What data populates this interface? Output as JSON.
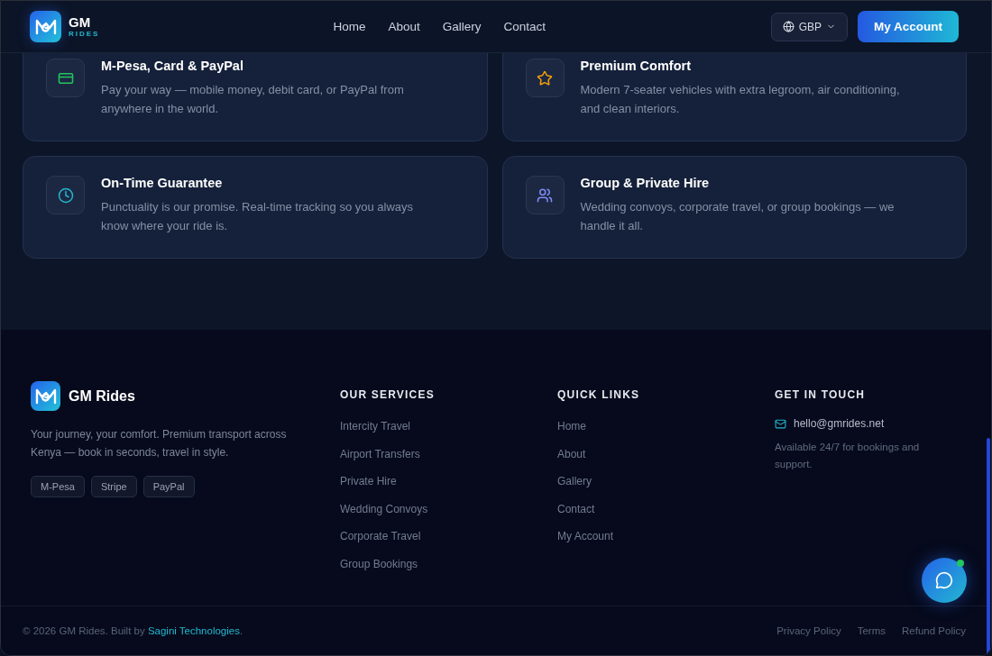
{
  "nav": {
    "logo": {
      "title": "GM",
      "subtitle": "RIDES"
    },
    "links": [
      "Home",
      "About",
      "Gallery",
      "Contact"
    ],
    "currency": "GBP",
    "account_button": "My Account"
  },
  "features": [
    {
      "kind": "card",
      "title": "M-Pesa, Card & PayPal",
      "text": "Pay your way — mobile money, debit card, or PayPal from anywhere in the world.",
      "color": "#22c55e"
    },
    {
      "kind": "star",
      "title": "Premium Comfort",
      "text": "Modern 7-seater vehicles with extra legroom, air conditioning, and clean interiors.",
      "color": "#f59e0b"
    },
    {
      "kind": "clock",
      "title": "On-Time Guarantee",
      "text": "Punctuality is our promise. Real-time tracking so you always know where your ride is.",
      "color": "#22b8cf"
    },
    {
      "kind": "users",
      "title": "Group & Private Hire",
      "text": "Wedding convoys, corporate travel, or group bookings — we handle it all.",
      "color": "#818cf8"
    }
  ],
  "footer": {
    "brand": "GM Rides",
    "tagline": "Your journey, your comfort. Premium transport across Kenya — book in seconds, travel in style.",
    "payments": [
      "M-Pesa",
      "Stripe",
      "PayPal"
    ],
    "columns": [
      {
        "heading": "OUR SERVICES",
        "links": [
          "Intercity Travel",
          "Airport Transfers",
          "Private Hire",
          "Wedding Convoys",
          "Corporate Travel",
          "Group Bookings"
        ]
      },
      {
        "heading": "QUICK LINKS",
        "links": [
          "Home",
          "About",
          "Gallery",
          "Contact",
          "My Account"
        ]
      }
    ],
    "contact": {
      "heading": "GET IN TOUCH",
      "email": "hello@gmrides.net",
      "note": "Available 24/7 for bookings and support."
    },
    "copyright": "© 2026 GM Rides. Built by",
    "credit": "Sagini Technologies",
    "credit_end": ".",
    "legal": [
      "Privacy Policy",
      "Terms",
      "Refund Policy"
    ]
  },
  "chat": {
    "online": true
  }
}
